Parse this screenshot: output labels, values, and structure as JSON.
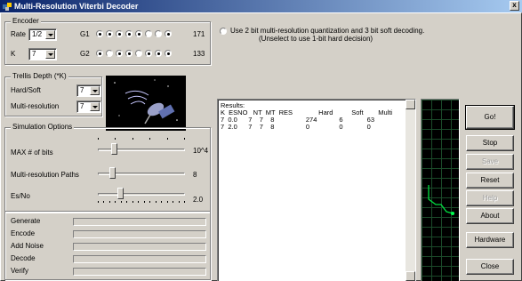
{
  "window": {
    "title": "Multi-Resolution Viterbi Decoder",
    "close_glyph": "x"
  },
  "encoder": {
    "title": "Encoder",
    "rate_label": "Rate",
    "rate_value": "1/2",
    "k_label": "K",
    "k_value": "7",
    "g1_label": "G1",
    "g1_bits": [
      1,
      1,
      1,
      1,
      1,
      0,
      0,
      1
    ],
    "g1_value": "171",
    "g2_label": "G2",
    "g2_bits": [
      1,
      0,
      1,
      1,
      0,
      1,
      1,
      1
    ],
    "g2_value": "133"
  },
  "option": {
    "text_line1": "Use 2 bit multi-resolution quantization and 3 bit soft decoding.",
    "text_line2": "(Unselect to use 1-bit hard decision)",
    "checked": false
  },
  "trellis": {
    "title": "Trellis Depth (*K)",
    "hard_soft_label": "Hard/Soft",
    "hard_soft_value": "7",
    "multires_label": "Multi-resolution",
    "multires_value": "7"
  },
  "simulation": {
    "title": "Simulation Options",
    "max_bits_label": "MAX # of bits",
    "max_bits_value": "10^4",
    "max_bits_level": 0.17,
    "paths_label": "Multi-resolution Paths",
    "paths_value": "8",
    "paths_level": 0.14,
    "esno_label": "Es/No",
    "esno_value": "2.0",
    "esno_level": 0.24
  },
  "progress": {
    "items": [
      {
        "label": "Generate"
      },
      {
        "label": "Encode"
      },
      {
        "label": "Add Noise"
      },
      {
        "label": "Decode"
      },
      {
        "label": "Verify"
      }
    ]
  },
  "results": {
    "lines": [
      "Results:",
      "K  ESNO   NT  MT  RES              Hard          Soft        Multi",
      "7  0.0      7    7    8                 274            6             63",
      "7  2.0      7    7    8                 0                0             0"
    ]
  },
  "buttons": {
    "go": "Go!",
    "stop": "Stop",
    "save": "Save",
    "reset": "Reset",
    "help": "Help",
    "about": "About",
    "hardware": "Hardware",
    "close": "Close"
  },
  "colors": {
    "scope_trace": "#00e040",
    "title_start": "#0a246a",
    "title_end": "#a6caf0"
  }
}
